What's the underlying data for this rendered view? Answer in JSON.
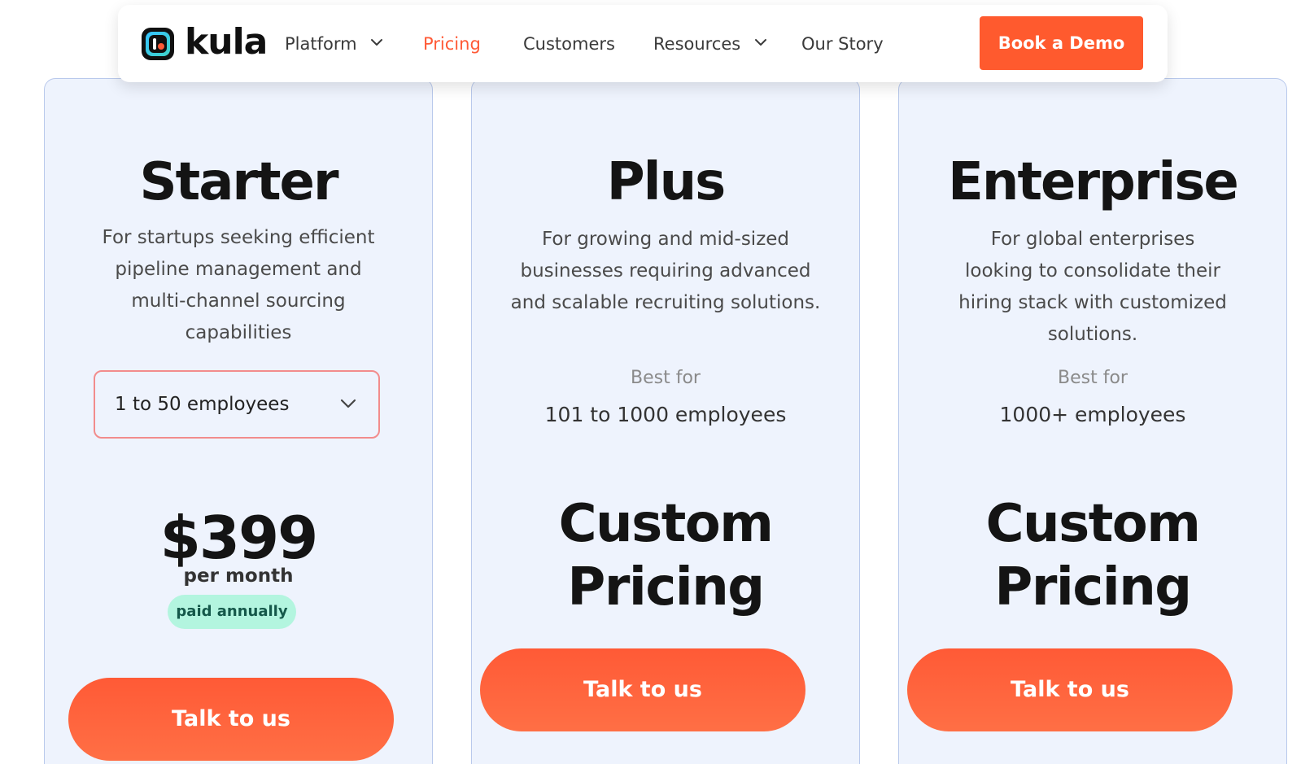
{
  "nav": {
    "logo_text": "kula",
    "items": [
      {
        "label": "Platform",
        "has_dropdown": true
      },
      {
        "label": "Pricing",
        "active": true
      },
      {
        "label": "Customers"
      },
      {
        "label": "Resources",
        "has_dropdown": true
      },
      {
        "label": "Our Story"
      }
    ],
    "cta_label": "Book a Demo",
    "accent_color": "#ff5a2e"
  },
  "plans": [
    {
      "name": "Starter",
      "description": "For startups seeking efficient pipeline management and multi-channel sourcing capabilities",
      "employee_select": "1 to 50 employees",
      "price": "$399",
      "period": "per month",
      "billing_badge": "paid annually",
      "cta": "Talk to us"
    },
    {
      "name": "Plus",
      "description": "For growing and mid-sized businesses requiring advanced and scalable recruiting solutions.",
      "best_for_label": "Best for",
      "best_for_value": "101 to 1000 employees",
      "price_line1": "Custom",
      "price_line2": "Pricing",
      "cta": "Talk to us"
    },
    {
      "name": "Enterprise",
      "description": "For global enterprises looking to consolidate their hiring stack with customized solutions.",
      "best_for_label": "Best for",
      "best_for_value": "1000+ employees",
      "price_line1": "Custom",
      "price_line2": "Pricing",
      "cta": "Talk to us"
    }
  ],
  "colors": {
    "card_bg": "#eef3fd",
    "card_border": "#b9c9ec",
    "cta_orange": "#ff5a36",
    "badge_bg": "#b3f5df"
  }
}
